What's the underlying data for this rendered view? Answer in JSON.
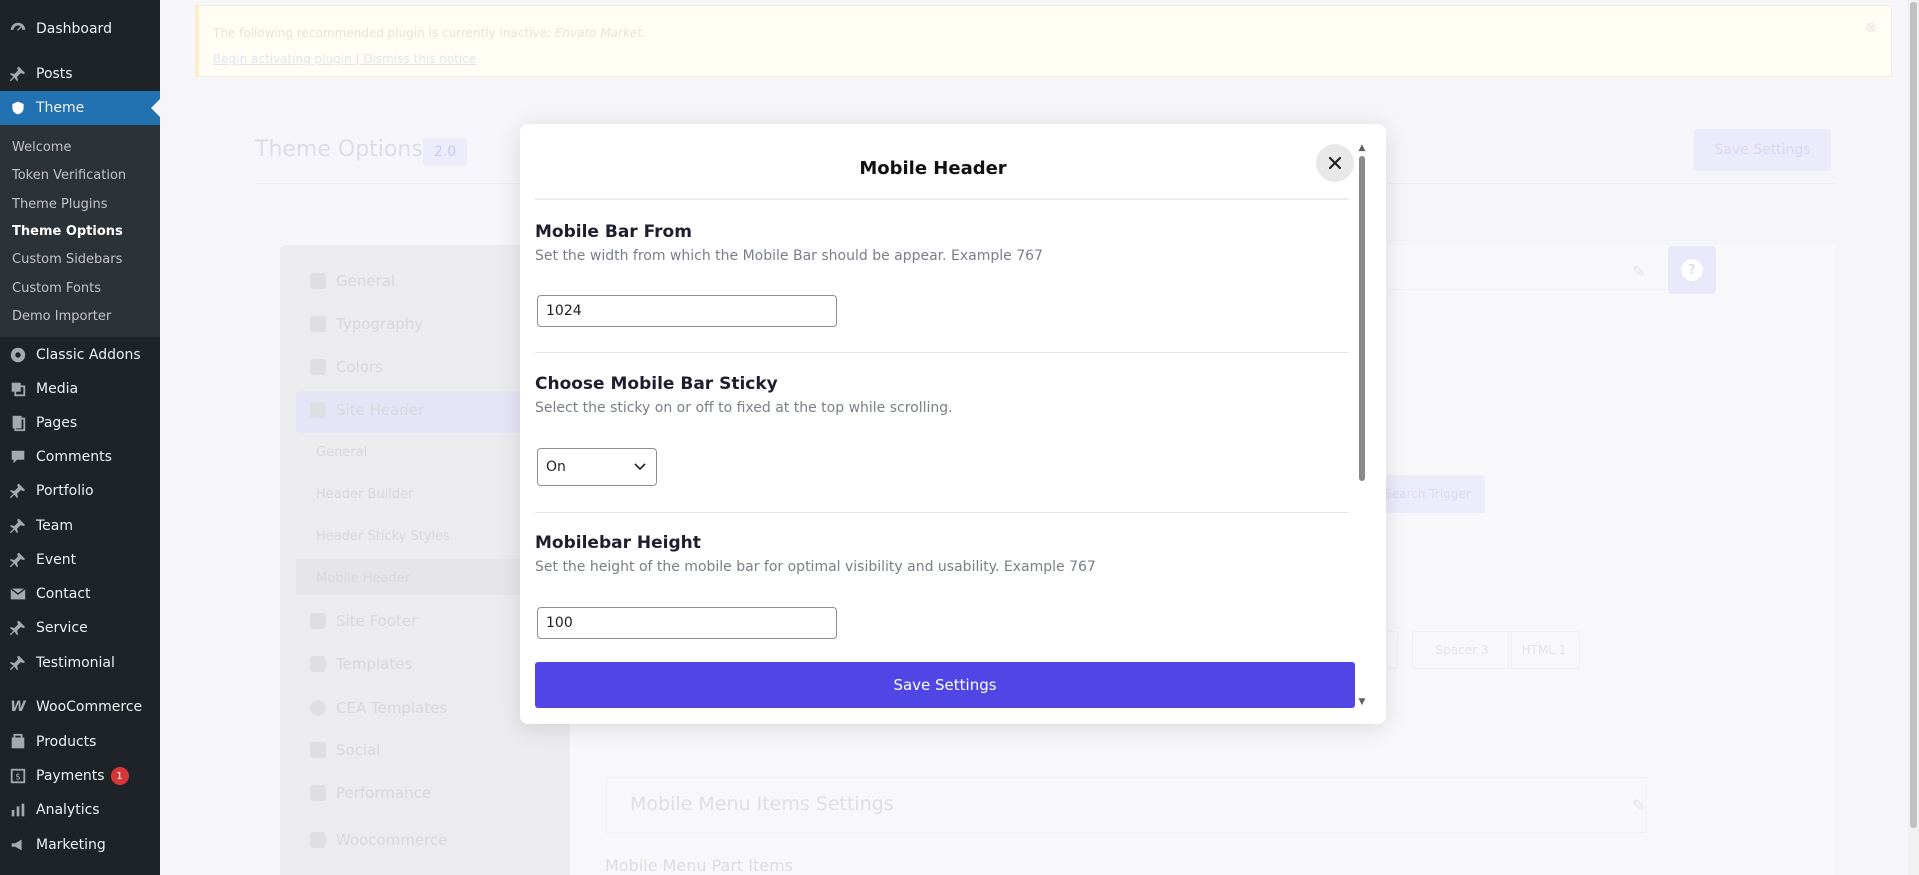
{
  "sidebar": {
    "items": [
      {
        "label": "Dashboard",
        "icon": "dashboard-icon"
      },
      {
        "label": "Posts",
        "icon": "pin-icon"
      },
      {
        "label": "Theme",
        "icon": "theme-icon"
      },
      {
        "label": "Classic Addons",
        "icon": "classic-addons-icon"
      },
      {
        "label": "Media",
        "icon": "media-icon"
      },
      {
        "label": "Pages",
        "icon": "pages-icon"
      },
      {
        "label": "Comments",
        "icon": "comments-icon"
      },
      {
        "label": "Portfolio",
        "icon": "pin-icon"
      },
      {
        "label": "Team",
        "icon": "pin-icon"
      },
      {
        "label": "Event",
        "icon": "pin-icon"
      },
      {
        "label": "Contact",
        "icon": "mail-icon"
      },
      {
        "label": "Service",
        "icon": "pin-icon"
      },
      {
        "label": "Testimonial",
        "icon": "pin-icon"
      },
      {
        "label": "WooCommerce",
        "icon": "woocommerce-icon"
      },
      {
        "label": "Products",
        "icon": "products-icon"
      },
      {
        "label": "Payments",
        "icon": "payments-icon",
        "badge": "1"
      },
      {
        "label": "Analytics",
        "icon": "analytics-icon"
      },
      {
        "label": "Marketing",
        "icon": "marketing-icon"
      }
    ],
    "theme_submenu": [
      "Welcome",
      "Token Verification",
      "Theme Plugins",
      "Theme Options",
      "Custom Sidebars",
      "Custom Fonts",
      "Demo Importer"
    ],
    "active_submenu": "Theme Options"
  },
  "notice": {
    "text": "The following recommended plugin is currently inactive: ",
    "plugin": "Envato Market.",
    "activate_link": "Begin activating plugin",
    "separator": "|",
    "dismiss_link": "Dismiss this notice"
  },
  "background": {
    "title": "Theme Options",
    "version": "2.0",
    "save_label": "Save Settings",
    "nav": [
      "General",
      "Typography",
      "Colors",
      "Site Header",
      "Site Footer",
      "Templates",
      "CEA Templates",
      "Social",
      "Performance",
      "Woocommerce"
    ],
    "header_subnav": [
      "General",
      "Header Builder",
      "Header Sticky Styles",
      "Mobile Header"
    ],
    "search_trigger": "Search Trigger",
    "chips": [
      "Spacer 3",
      "HTML 1"
    ],
    "mobile_menu_title": "Mobile Menu Items Settings",
    "mobile_menu_part": "Mobile Menu Part Items"
  },
  "modal": {
    "title": "Mobile Header",
    "sections": [
      {
        "title": "Mobile Bar From",
        "desc": "Set the width from which the Mobile Bar should be appear. Example 767",
        "value": "1024"
      },
      {
        "title": "Choose Mobile Bar Sticky",
        "desc": "Select the sticky on or off to fixed at the top while scrolling.",
        "value": "On"
      },
      {
        "title": "Mobilebar Height",
        "desc": "Set the height of the mobile bar for optimal visibility and usability. Example 767",
        "value": "100"
      }
    ],
    "save_label": "Save Settings"
  },
  "colors": {
    "sidebar_bg": "#1d2327",
    "sidebar_active": "#2271b1",
    "accent": "#4f46e5",
    "badge": "#d63638"
  }
}
